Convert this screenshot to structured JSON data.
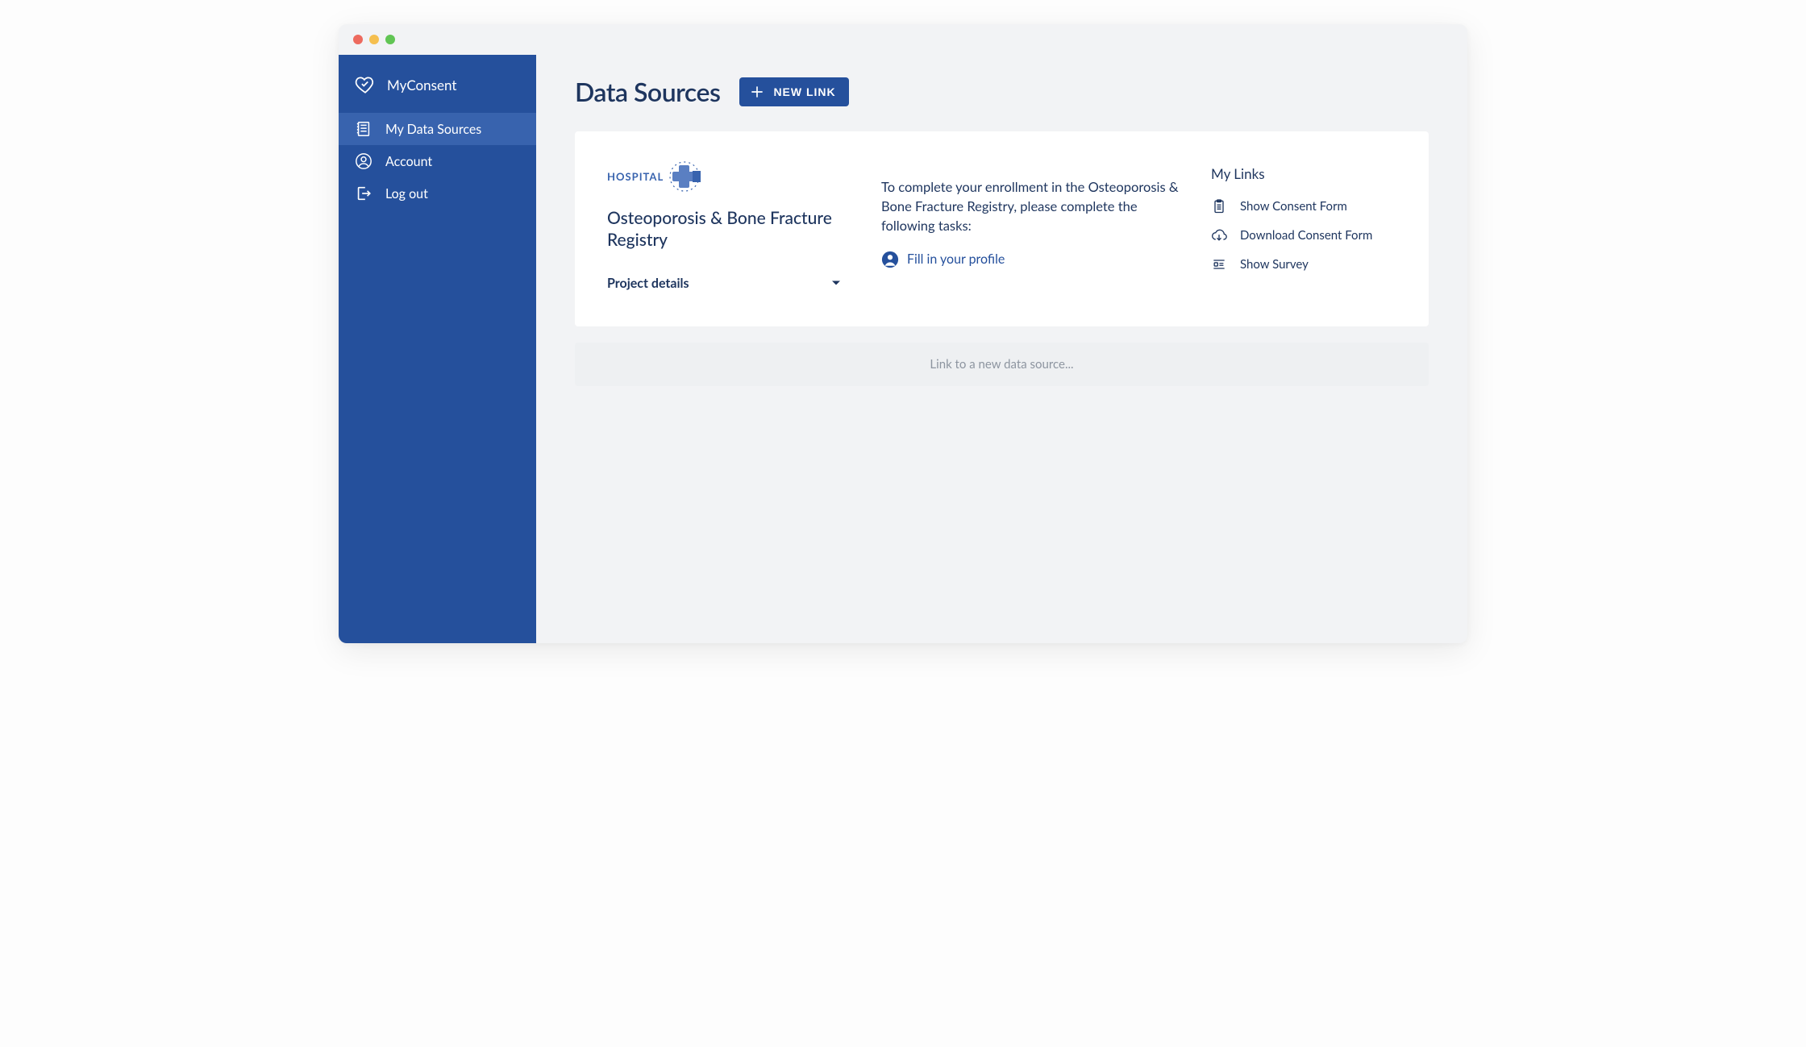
{
  "sidebar": {
    "brand": "MyConsent",
    "items": [
      {
        "label": "My Data Sources"
      },
      {
        "label": "Account"
      },
      {
        "label": "Log out"
      }
    ]
  },
  "header": {
    "title": "Data Sources",
    "new_link_label": "NEW LINK"
  },
  "source": {
    "logo_text": "HOSPITAL",
    "title": "Osteoporosis & Bone Fracture Registry",
    "details_label": "Project details",
    "instruction": "To complete your enrollment in the Osteoporosis & Bone Fracture Registry, please complete the following tasks:",
    "tasks": [
      {
        "label": "Fill in your profile"
      }
    ],
    "links_title": "My Links",
    "links": [
      {
        "label": "Show Consent Form"
      },
      {
        "label": "Download Consent Form"
      },
      {
        "label": "Show Survey"
      }
    ]
  },
  "placeholder": "Link to a new data source..."
}
